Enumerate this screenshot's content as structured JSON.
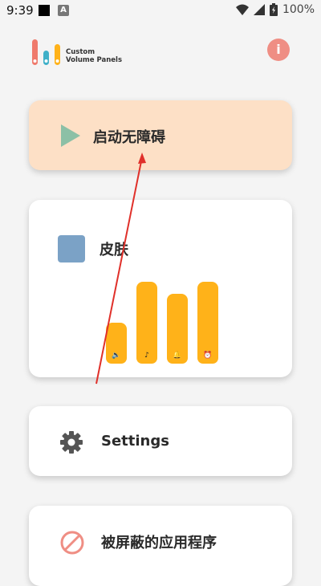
{
  "status_bar": {
    "time": "9:39",
    "notification_icon_letter": "A",
    "battery_percent": "100%"
  },
  "header": {
    "app_title_line1": "Custom",
    "app_title_line2": "Volume Panels",
    "info_glyph": "i"
  },
  "cards": {
    "start": {
      "label": "启动无障碍",
      "icon": "play-icon"
    },
    "skin": {
      "label": "皮肤",
      "swatch_color": "#7ba2c6",
      "sliders": [
        {
          "name": "media",
          "icon": "speaker-icon",
          "glyph": "🔈",
          "level": 0.5
        },
        {
          "name": "music",
          "icon": "music-note-icon",
          "glyph": "♪",
          "level": 1.0
        },
        {
          "name": "notification",
          "icon": "bell-icon",
          "glyph": "🔔",
          "level": 0.85
        },
        {
          "name": "alarm",
          "icon": "alarm-icon",
          "glyph": "⏰",
          "level": 1.0
        }
      ]
    },
    "settings": {
      "label": "Settings",
      "icon": "gear-icon"
    },
    "blocked": {
      "label": "被屏蔽的应用程序",
      "icon": "block-icon"
    }
  },
  "colors": {
    "accent": "#ffb219",
    "start_card": "#fde0c6",
    "info_button": "#ef8e84",
    "play": "#8cc0a6",
    "annotation_arrow": "#e0302a"
  }
}
